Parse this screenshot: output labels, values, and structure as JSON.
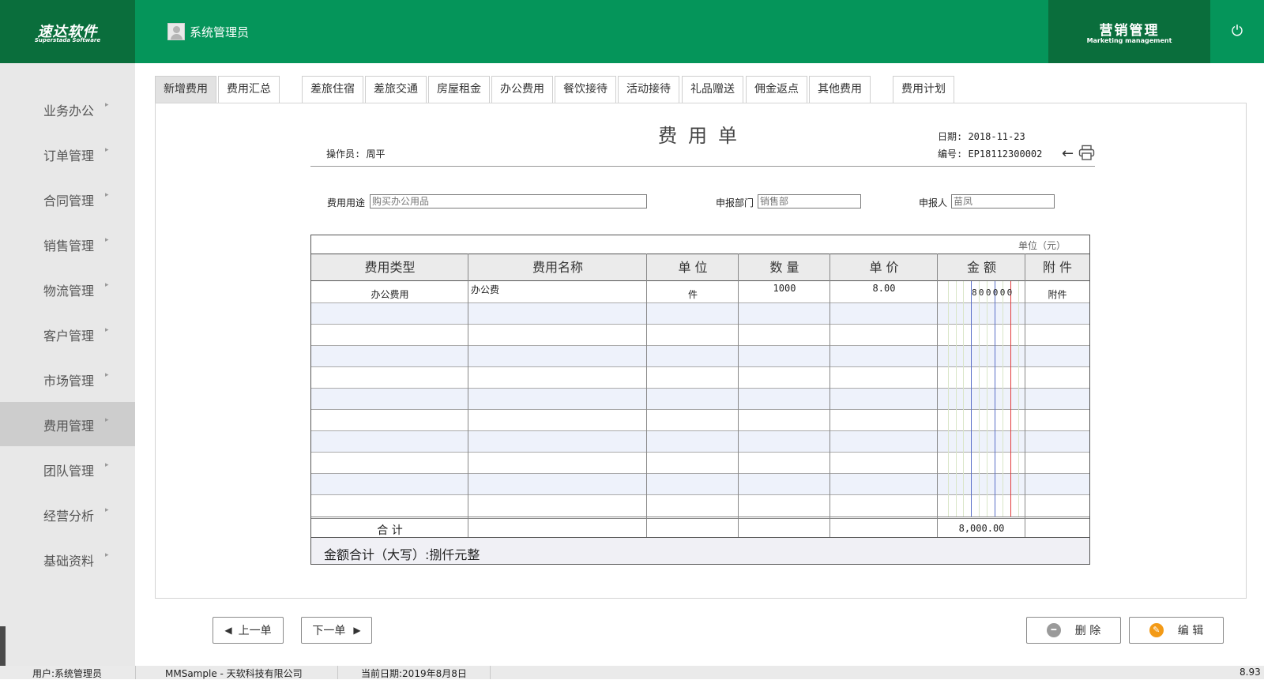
{
  "app": {
    "logo_cn": "速达软件",
    "logo_en": "Superstada Software",
    "user_label": "系统管理员",
    "module_cn": "营销管理",
    "module_en": "Marketing management",
    "power_icon": "power-icon"
  },
  "sidebar": {
    "items": [
      {
        "label": "业务办公"
      },
      {
        "label": "订单管理"
      },
      {
        "label": "合同管理"
      },
      {
        "label": "销售管理"
      },
      {
        "label": "物流管理"
      },
      {
        "label": "客户管理"
      },
      {
        "label": "市场管理"
      },
      {
        "label": "费用管理",
        "active": true
      },
      {
        "label": "团队管理"
      },
      {
        "label": "经营分析"
      },
      {
        "label": "基础资料"
      }
    ],
    "arrow": "▸"
  },
  "tabs": [
    {
      "label": "新增费用",
      "active": true
    },
    {
      "label": "费用汇总"
    },
    {
      "label": "差旅住宿"
    },
    {
      "label": "差旅交通"
    },
    {
      "label": "房屋租金"
    },
    {
      "label": "办公费用"
    },
    {
      "label": "餐饮接待"
    },
    {
      "label": "活动接待"
    },
    {
      "label": "礼品赠送"
    },
    {
      "label": "佣金返点"
    },
    {
      "label": "其他费用"
    },
    {
      "label": "费用计划"
    }
  ],
  "document": {
    "title": "费用单",
    "operator": "操作员: 周平",
    "date": "日期: 2018-11-23",
    "number": "编号: EP18112300002",
    "fields": {
      "purpose_label": "费用用途",
      "purpose_value": "购买办公用品",
      "dept_label": "申报部门",
      "dept_value": "销售部",
      "applicant_label": "申报人",
      "applicant_value": "苗凤"
    }
  },
  "table": {
    "unit_note": "单位（元）",
    "headers": [
      "费用类型",
      "费用名称",
      "单 位",
      "数 量",
      "单 价",
      "金 额",
      "附 件"
    ],
    "rows": [
      {
        "type": "办公费用",
        "name": "办公费",
        "unit": "件",
        "qty": "1000",
        "price": "8.00",
        "amount": "800000",
        "attach": "附件"
      }
    ],
    "sum_label": "合 计",
    "sum_amount": "8,000.00",
    "caps": "金额合计（大写）:捌仟元整"
  },
  "buttons": {
    "prev": "上一单",
    "next": "下一单",
    "delete": "删 除",
    "edit": "编 辑"
  },
  "status": {
    "user": "用户:系统管理员",
    "company": "MMSample - 天软科技有限公司",
    "date": "当前日期:2019年8月8日",
    "version": "8.93"
  },
  "colors": {
    "header": "#05955a",
    "header_dark": "#0a6e3c",
    "edit_icon": "#f39a16",
    "delete_icon": "#9a9a9a",
    "red_line": "#e23b3b",
    "blue_line": "#5a6fc8"
  }
}
